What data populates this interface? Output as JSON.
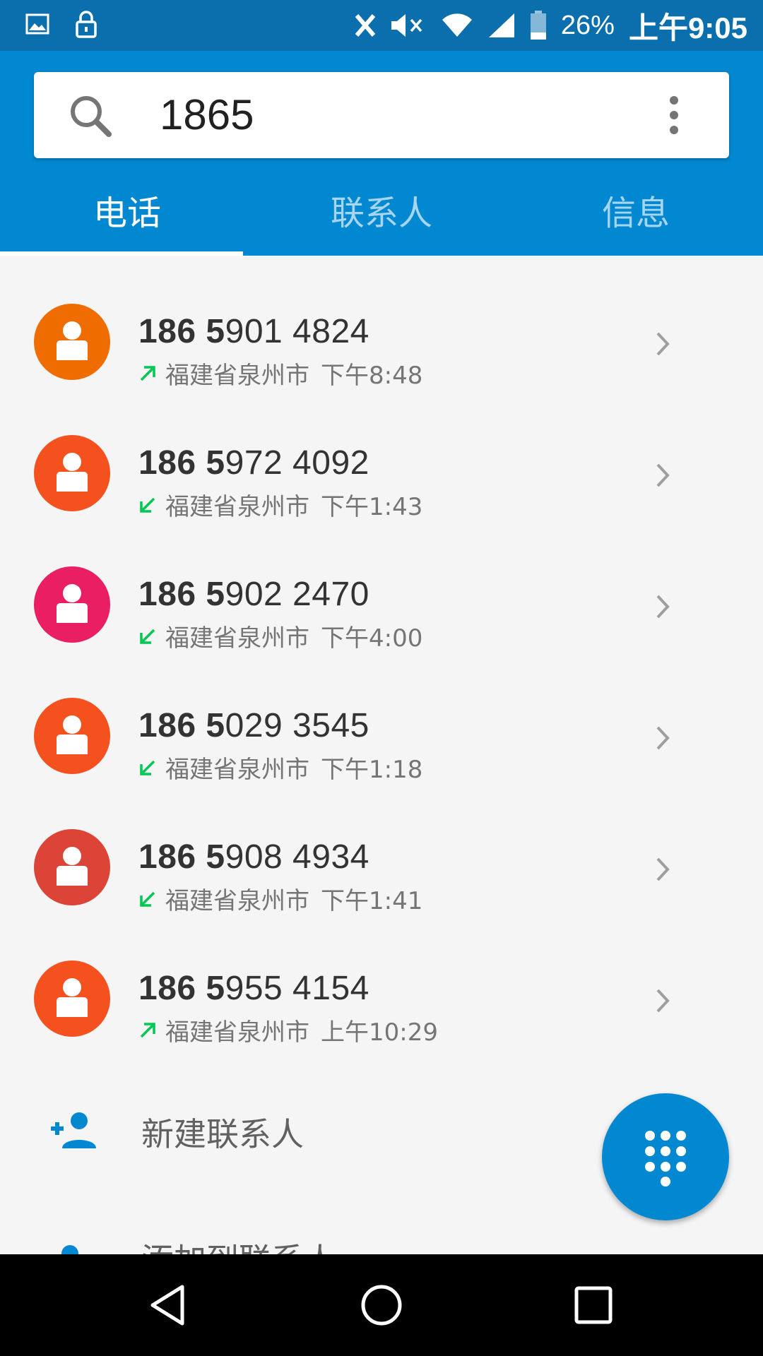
{
  "status_bar": {
    "battery": "26%",
    "time": "上午9:05"
  },
  "search": {
    "query": "1865",
    "placeholder": ""
  },
  "tabs": [
    {
      "label": "电话",
      "active": true
    },
    {
      "label": "联系人",
      "active": false
    },
    {
      "label": "信息",
      "active": false
    }
  ],
  "calls": [
    {
      "number_bold": "186 5",
      "number_rest": "901 4824",
      "direction": "outgoing",
      "location": "福建省泉州市",
      "time": "下午8:48",
      "avatar_color": "#ef6c00"
    },
    {
      "number_bold": "186 5",
      "number_rest": "972 4092",
      "direction": "incoming",
      "location": "福建省泉州市",
      "time": "下午1:43",
      "avatar_color": "#f4511e"
    },
    {
      "number_bold": "186 5",
      "number_rest": "902 2470",
      "direction": "incoming",
      "location": "福建省泉州市",
      "time": "下午4:00",
      "avatar_color": "#e91e63"
    },
    {
      "number_bold": "186 5",
      "number_rest": "029 3545",
      "direction": "incoming",
      "location": "福建省泉州市",
      "time": "下午1:18",
      "avatar_color": "#f4511e"
    },
    {
      "number_bold": "186 5",
      "number_rest": "908 4934",
      "direction": "incoming",
      "location": "福建省泉州市",
      "time": "下午1:41",
      "avatar_color": "#db4437"
    },
    {
      "number_bold": "186 5",
      "number_rest": "955 4154",
      "direction": "outgoing",
      "location": "福建省泉州市",
      "time": "上午10:29",
      "avatar_color": "#f4511e"
    }
  ],
  "actions": {
    "new_contact": "新建联系人",
    "add_to_contact": "添加到联系人"
  },
  "colors": {
    "primary": "#0288d1",
    "status_bar": "#0b6fae",
    "call_arrow": "#00c853"
  }
}
